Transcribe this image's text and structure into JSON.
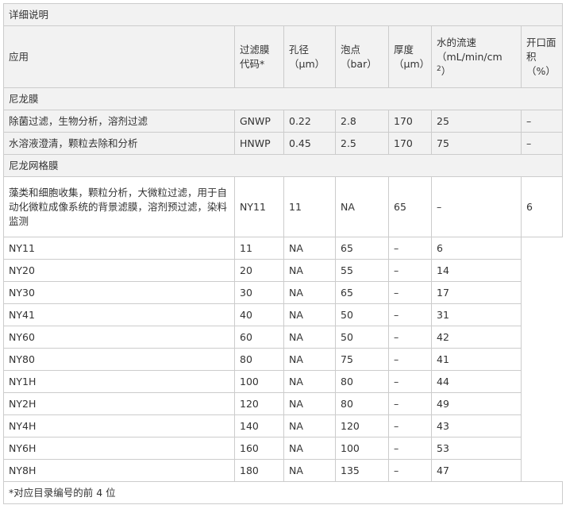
{
  "title": "详细说明",
  "header": {
    "application": "应用",
    "code": "过滤膜代码*",
    "pore": "孔径",
    "pore_unit": "（μm）",
    "bubble": "泡点",
    "bubble_unit": "（bar）",
    "thickness": "厚度",
    "thickness_unit": "（μm）",
    "flow": "水的流速",
    "flow_unit": "（mL/min/cm",
    "flow_exp": "2",
    "flow_end": "）",
    "open": "开口面积",
    "open_unit": "（%）"
  },
  "section1": "尼龙膜",
  "rows1": [
    {
      "app": "除菌过滤，生物分析，溶剂过滤",
      "code": "GNWP",
      "pore": "0.22",
      "bubble": "2.8",
      "thick": "170",
      "flow": "25",
      "open": "–"
    },
    {
      "app": "水溶液澄清，颗粒去除和分析",
      "code": "HNWP",
      "pore": "0.45",
      "bubble": "2.5",
      "thick": "170",
      "flow": "75",
      "open": "–"
    }
  ],
  "section2": "尼龙网格膜",
  "mesh_main": {
    "app": "藻类和细胞收集，颗粒分析，大微粒过滤，用于自动化微粒成像系统的背景滤膜，溶剂预过滤，染料监测",
    "code": "NY11",
    "pore": "11",
    "bubble": "NA",
    "thick": "65",
    "flow": "–",
    "open": "6"
  },
  "mesh_rows": [
    {
      "c1": "NY11",
      "c2": "11",
      "c3": "NA",
      "c4": "65",
      "c5": "–",
      "c6": "6"
    },
    {
      "c1": "NY20",
      "c2": "20",
      "c3": "NA",
      "c4": "55",
      "c5": "–",
      "c6": "14"
    },
    {
      "c1": "NY30",
      "c2": "30",
      "c3": "NA",
      "c4": "65",
      "c5": "–",
      "c6": "17"
    },
    {
      "c1": "NY41",
      "c2": "40",
      "c3": "NA",
      "c4": "50",
      "c5": "–",
      "c6": "31"
    },
    {
      "c1": "NY60",
      "c2": "60",
      "c3": "NA",
      "c4": "50",
      "c5": "–",
      "c6": "42"
    },
    {
      "c1": "NY80",
      "c2": "80",
      "c3": "NA",
      "c4": "75",
      "c5": "–",
      "c6": "41"
    },
    {
      "c1": "NY1H",
      "c2": "100",
      "c3": "NA",
      "c4": "80",
      "c5": "–",
      "c6": "44"
    },
    {
      "c1": "NY2H",
      "c2": "120",
      "c3": "NA",
      "c4": "80",
      "c5": "–",
      "c6": "49"
    },
    {
      "c1": "NY4H",
      "c2": "140",
      "c3": "NA",
      "c4": "120",
      "c5": "–",
      "c6": "43"
    },
    {
      "c1": "NY6H",
      "c2": "160",
      "c3": "NA",
      "c4": "100",
      "c5": "–",
      "c6": "53"
    },
    {
      "c1": "NY8H",
      "c2": "180",
      "c3": "NA",
      "c4": "135",
      "c5": "–",
      "c6": "47"
    }
  ],
  "footnote": "*对应目录编号的前 4 位"
}
